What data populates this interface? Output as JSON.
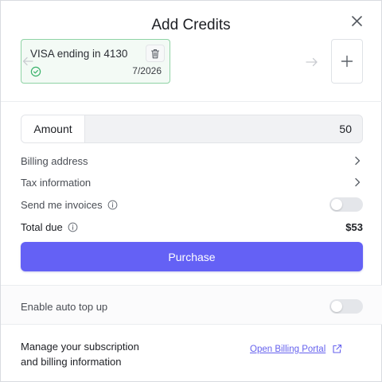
{
  "dialog": {
    "title": "Add Credits"
  },
  "card": {
    "label": "VISA ending in 4130",
    "expiry": "7/2026"
  },
  "amount": {
    "label": "Amount",
    "value": "50"
  },
  "rows": {
    "billing_address": "Billing address",
    "tax_information": "Tax information",
    "send_invoices": "Send me invoices",
    "total_due_label": "Total due",
    "total_due_value": "$53"
  },
  "toggles": {
    "send_invoices": false,
    "auto_top_up": false
  },
  "purchase_label": "Purchase",
  "auto_top_up_label": "Enable auto top up",
  "manage": {
    "line1": "Manage your subscription",
    "line2": "and billing information",
    "link": "Open Billing Portal"
  },
  "colors": {
    "accent": "#6461f5",
    "card_border": "#8fd3a5",
    "link": "#6662ee"
  },
  "icons": [
    "close-icon",
    "trash-icon",
    "check-circle-icon",
    "arrow-left-icon",
    "arrow-right-icon",
    "plus-icon",
    "chevron-right-icon",
    "info-icon",
    "external-link-icon"
  ]
}
